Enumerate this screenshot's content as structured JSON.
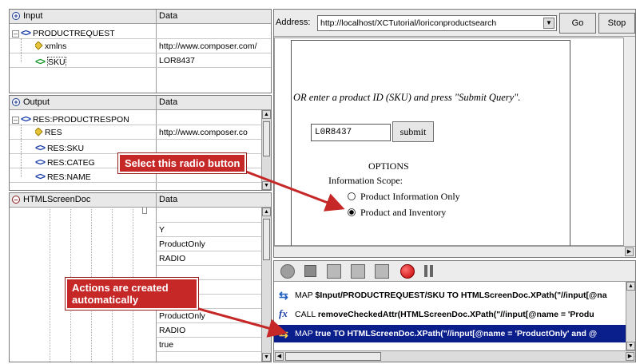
{
  "input_panel": {
    "col1": "Input",
    "col2": "Data",
    "rows": [
      {
        "name": "PRODUCTREQUEST",
        "value": ""
      },
      {
        "name": "xmlns",
        "value": "http://www.composer.com/"
      },
      {
        "name": "SKU",
        "value": "LOR8437"
      }
    ]
  },
  "output_panel": {
    "col1": "Output",
    "col2": "Data",
    "rows": [
      {
        "name": "RES:PRODUCTRESPON",
        "value": ""
      },
      {
        "name": "RES",
        "value": "http://www.composer.co"
      },
      {
        "name": "RES:SKU",
        "value": ""
      },
      {
        "name": "RES:CATEG",
        "value": ""
      },
      {
        "name": "RES:NAME",
        "value": ""
      }
    ]
  },
  "screendoc_panel": {
    "col1": "HTMLScreenDoc",
    "col2": "Data",
    "values_top": [
      "Y",
      "ProductOnly",
      "RADIO"
    ],
    "values_bottom": [
      "ProductOnly",
      "RADIO",
      "true"
    ]
  },
  "browser": {
    "address_label": "Address:",
    "address_value": "http://localhost/XCTutorial/loriconproductsearch",
    "go_label": "Go",
    "stop_label": "Stop",
    "instruction": "OR enter a product ID (SKU) and press \"Submit Query\".",
    "sku_value": "L0R8437",
    "submit_label": "submit",
    "options_heading": "OPTIONS",
    "scope_label": "Information Scope:",
    "radio_1": "Product Information Only",
    "radio_2": "Product and Inventory",
    "selected_radio": "Product and Inventory"
  },
  "actions": {
    "rows": [
      {
        "keyword": "MAP",
        "text": "$Input/PRODUCTREQUEST/SKU TO HTMLScreenDoc.XPath(\"//input[@na"
      },
      {
        "keyword": "CALL",
        "text": "removeCheckedAttr(HTMLScreenDoc.XPath(\"//input[@name = 'Produ"
      },
      {
        "keyword": "MAP",
        "text": "true TO HTMLScreenDoc.XPath(\"//input[@name = 'ProductOnly' and @"
      }
    ]
  },
  "callouts": {
    "radio": "Select this radio button",
    "actions": "Actions are created automatically"
  },
  "colors": {
    "callout": "#c62828",
    "selected_row": "#0a1e8c",
    "tag_blue": "#1d3fa8",
    "tag_green": "#159a2b"
  }
}
